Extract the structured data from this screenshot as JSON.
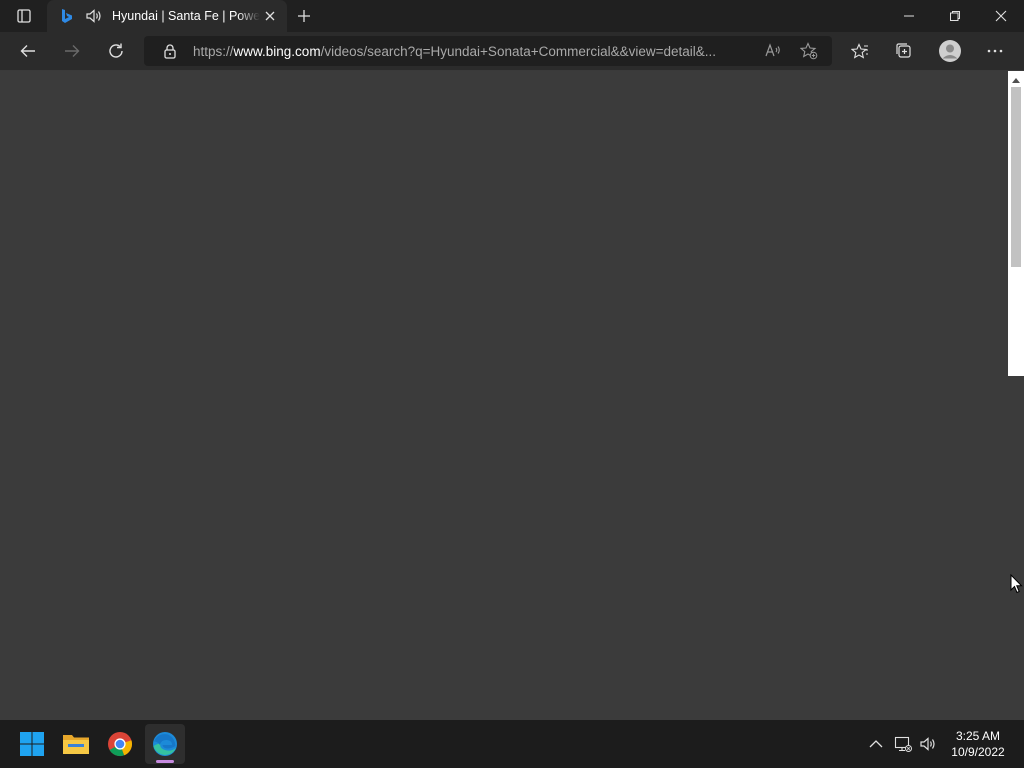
{
  "browser": {
    "tab": {
      "title": "Hyundai | Santa Fe | Power Your Adventure"
    },
    "address_bar": {
      "url_prefix": "https://",
      "url_host": "www.bing.com",
      "url_path": "/videos/search?q=Hyundai+Sonata+Commercial&&view=detail&..."
    }
  },
  "taskbar": {
    "apps": [
      "start-icon",
      "file-explorer-icon",
      "chrome-icon",
      "edge-icon"
    ],
    "clock": {
      "time": "3:25 AM",
      "date": "10/9/2022"
    }
  },
  "colors": {
    "content_background": "#3b3b3b",
    "chrome_background": "#202020",
    "edge_indicator": "#c78be0"
  }
}
